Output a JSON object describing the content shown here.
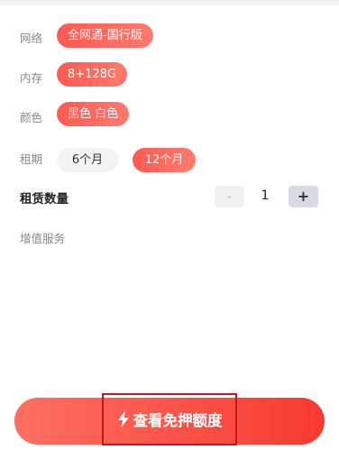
{
  "network": {
    "label": "网络",
    "options": [
      "全网通-国行版"
    ],
    "selected_index": 0
  },
  "memory": {
    "label": "内存",
    "options": [
      "8+128G"
    ],
    "selected_index": 0
  },
  "color": {
    "label": "颜色",
    "options": [
      "黑色 白色"
    ],
    "selected_index": 0
  },
  "term": {
    "label": "租期",
    "options": [
      "6个月",
      "12个月"
    ],
    "selected_index": 1
  },
  "quantity": {
    "label": "租赁数量",
    "minus": "-",
    "value": "1",
    "plus": "+"
  },
  "services": {
    "label": "增值服务"
  },
  "cta": {
    "label": "查看免押额度",
    "icon": "lightning-bolt-icon"
  },
  "colors": {
    "accent": "#f8493f",
    "chip_unselected": "#f3f3f6"
  }
}
